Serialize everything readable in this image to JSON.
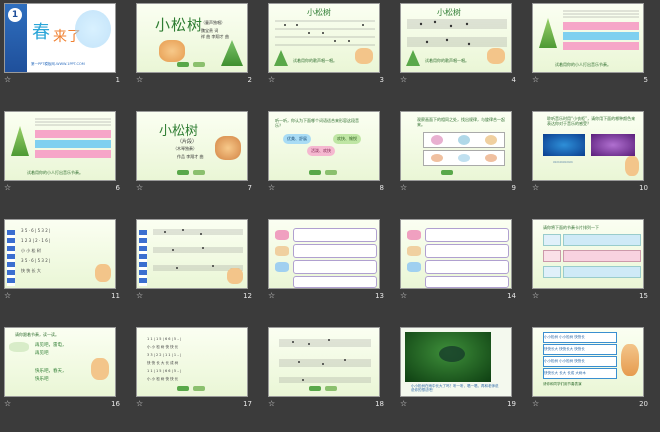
{
  "slides": [
    {
      "number": "1",
      "title_line": "春",
      "title_line2": "来了",
      "badge": "1",
      "footer": "第一PPT模板网-WWW.1PPT.COM"
    },
    {
      "number": "2",
      "title": "小松树",
      "subtitle": "（童声独唱）",
      "credits1": "魏宝贵 词",
      "credits2": "祥 曲 李翔才 曲"
    },
    {
      "number": "3",
      "title": "小松树",
      "caption": "试着用你的歌声唱一唱。"
    },
    {
      "number": "4",
      "title": "小松树",
      "caption": "试着用你的歌声唱一唱。"
    },
    {
      "number": "5",
      "caption": "试着用你的小人打出音乐节奏。"
    },
    {
      "number": "6",
      "caption": "试着用你的小人打出音乐节奏。"
    },
    {
      "number": "7",
      "title": "小松树",
      "subtitle": "（片段）",
      "subtitle2": "（木琴独奏）",
      "credits": "作品 李翔才 曲"
    },
    {
      "number": "8",
      "prompt": "听一听，你认为下面哪个词语适合来形容这段音乐？",
      "opt1": "优美、舒展",
      "opt2": "欢快、愉悦",
      "opt3": "活泼、欢快"
    },
    {
      "number": "9",
      "prompt": "观察画面下的相同之处，找出规律，与旋律合一起来。"
    },
    {
      "number": "10",
      "prompt": "聆听音乐时用“小衣柜”，请你用下面的哪种颜色来表达你对于音乐的感受？"
    },
    {
      "number": "11"
    },
    {
      "number": "12"
    },
    {
      "number": "13"
    },
    {
      "number": "14"
    },
    {
      "number": "15",
      "prompt": "请你将下面的节奏卡片排列一下"
    },
    {
      "number": "16",
      "prompt": "请你跟着节奏，读一读。",
      "line1": "再见吧，雷电，",
      "line2": "再见吧",
      "line3": "快乐吧，春天，",
      "line4": "快乐吧"
    },
    {
      "number": "17"
    },
    {
      "number": "18"
    },
    {
      "number": "19",
      "caption": "小小松树在雨中长大了吗？听一听，唱一唱，再和老师说说你的想法吧！"
    },
    {
      "number": "20",
      "row1": "小小松树 小小松树 快快长",
      "row2": "快快长大 快快长大 快快长",
      "row3": "小小松树 小小松树 快快长",
      "row4": "快快长大 长大 长成 大树木",
      "caption": "请你和同学们用节奏表演"
    }
  ],
  "colors": {
    "background": "#3b3b3b",
    "slide_bg": "#f3fae3",
    "accent_green": "#2d8a2d",
    "title_green": "#2e7d32",
    "pink": "#f6a6c8",
    "sky": "#7fd0f0"
  }
}
